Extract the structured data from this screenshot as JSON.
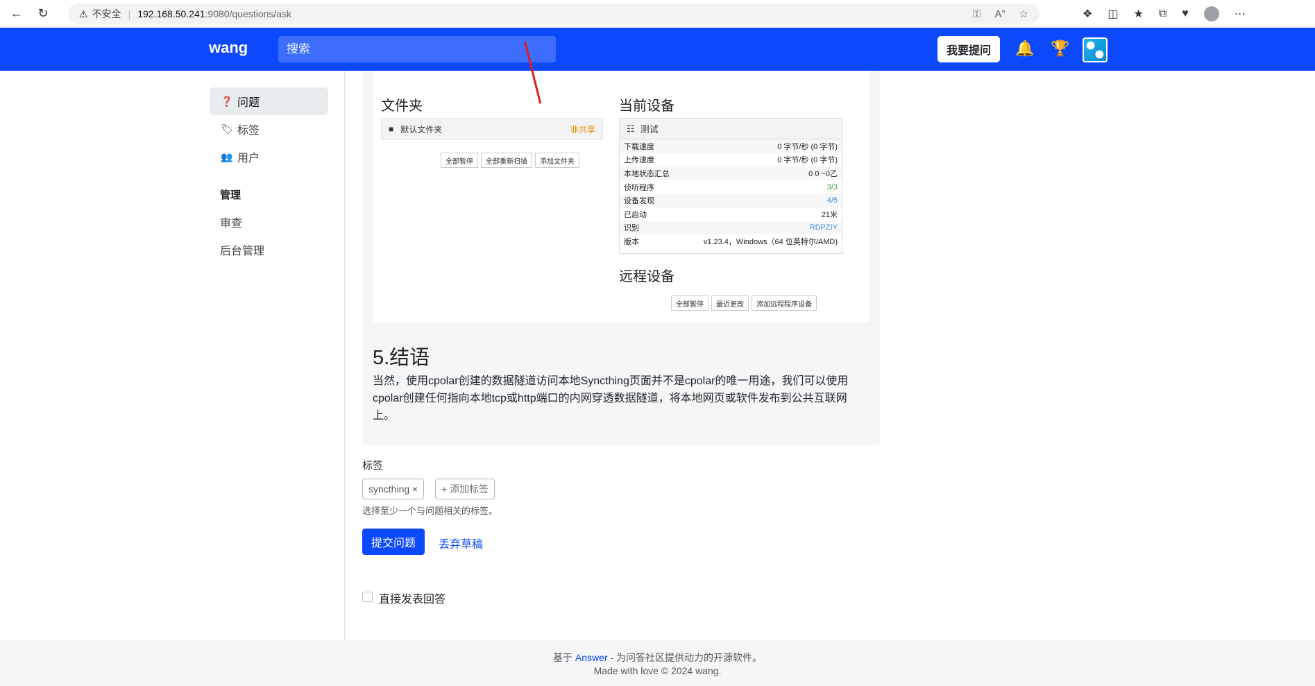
{
  "browser": {
    "insecure_label": "不安全",
    "url_host": "192.168.50.241",
    "url_rest": ":9080/questions/ask"
  },
  "header": {
    "brand": "wang",
    "search_placeholder": "搜索",
    "ask_button": "我要提问"
  },
  "sidebar": {
    "items": [
      {
        "label": "问题",
        "icon": "question-circle-icon"
      },
      {
        "label": "标签",
        "icon": "tags-icon"
      },
      {
        "label": "用户",
        "icon": "people-icon"
      }
    ],
    "admin_heading": "管理",
    "admin_links": [
      "审查",
      "后台管理"
    ]
  },
  "preview": {
    "screenshot": {
      "folders_title": "文件夹",
      "folder_name": "默认文件夹",
      "folder_status": "非共享",
      "folder_buttons": [
        "全部暂停",
        "全部重新扫描",
        "添加文件夹"
      ],
      "device_title": "当前设备",
      "device_name": "测试",
      "device_rows": [
        {
          "label": "下载速度",
          "value": "0 字节/秒 (0 字节)"
        },
        {
          "label": "上传速度",
          "value": "0 字节/秒 (0 字节)"
        },
        {
          "label": "本地状态汇总",
          "value": "0  0  ~0乙"
        },
        {
          "label": "侦听程序",
          "value": "3/3"
        },
        {
          "label": "设备发现",
          "value": "4/5"
        },
        {
          "label": "已启动",
          "value": "21米"
        },
        {
          "label": "识别",
          "value": "RDPZIY"
        },
        {
          "label": "版本",
          "value": "v1.23.4，Windows（64 位英特尔/AMD)"
        }
      ],
      "remote_title": "远程设备",
      "remote_buttons": [
        "全部暂停",
        "最近更改",
        "添加远程程序设备"
      ]
    },
    "heading": "5.结语",
    "paragraph": "当然，使用cpolar创建的数据隧道访问本地Syncthing页面并不是cpolar的唯一用途，我们可以使用cpolar创建任何指向本地tcp或http端口的内网穿透数据隧道，将本地网页或软件发布到公共互联网上。"
  },
  "form": {
    "tags_label": "标签",
    "tag": "syncthing ×",
    "add_tag": "+ 添加标签",
    "tags_hint": "选择至少一个与问题相关的标签。",
    "submit": "提交问题",
    "discard": "丢弃草稿",
    "answer_checkbox_label": "直接发表回答"
  },
  "footer": {
    "line1_prefix": "基于",
    "line1_link": "Answer",
    "line1_suffix": "- 为问答社区提供动力的开源软件。",
    "line2": "Made with love © 2024 wang."
  },
  "colors": {
    "brand_blue": "#0d49fc"
  }
}
